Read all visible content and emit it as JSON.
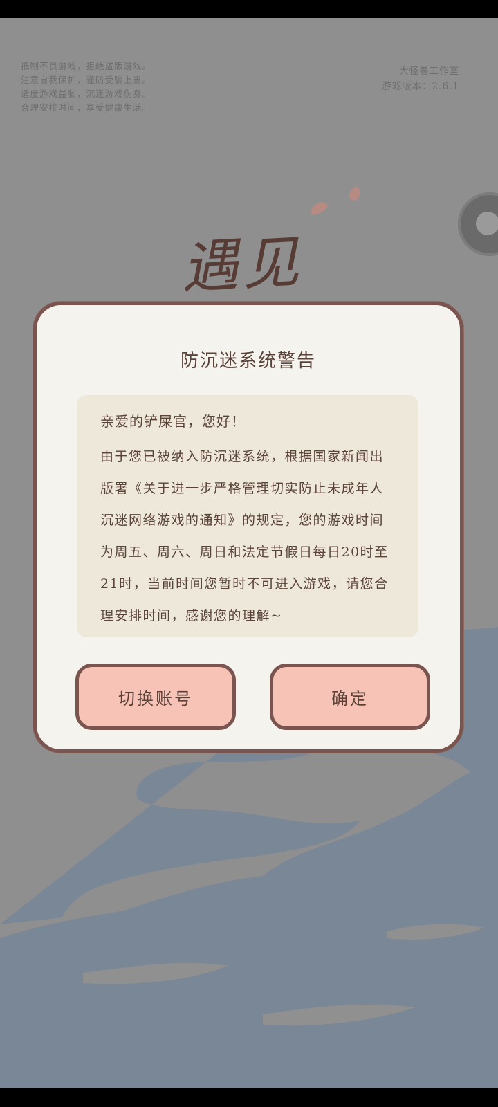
{
  "background": {
    "notice_lines": [
      "抵制不良游戏，拒绝盗版游戏。",
      "注意自我保护，谨防受骗上当。",
      "适度游戏益脑，沉迷游戏伤身。",
      "合理安排时间，享受健康生活。"
    ],
    "studio_name": "大怪兽工作室",
    "version_label": "游戏版本：2.6.1",
    "logo_text": "遇见"
  },
  "dialog": {
    "title": "防沉迷系统警告",
    "greeting": "亲爱的铲屎官，您好！",
    "body": "由于您已被纳入防沉迷系统，根据国家新闻出版署《关于进一步严格管理切实防止未成年人沉迷网络游戏的通知》的规定，您的游戏时间为周五、周六、周日和法定节假日每日20时至21时，当前时间您暂时不可进入游戏，请您合理安排时间，感谢您的理解~",
    "switch_account_label": "切换账号",
    "confirm_label": "确定"
  },
  "colors": {
    "dialog_bg": "#f5f3ee",
    "dialog_border": "#7a5550",
    "message_bg": "#ede8da",
    "button_bg": "#f7c3b6",
    "text": "#5a4238"
  },
  "icons": {
    "floating_ball": "floating-ball-icon"
  }
}
